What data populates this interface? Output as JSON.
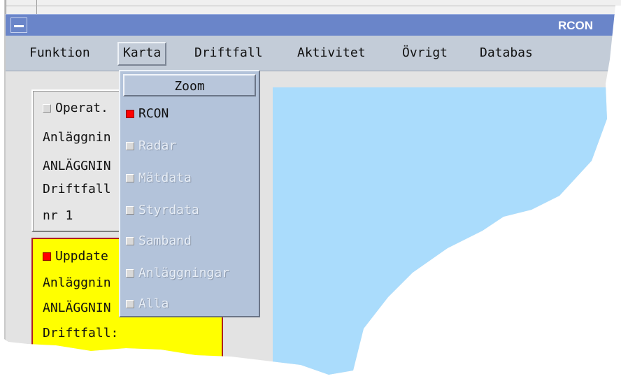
{
  "window": {
    "title": "RCON"
  },
  "menubar": {
    "items": [
      {
        "label": "Funktion"
      },
      {
        "label": "Karta"
      },
      {
        "label": "Driftfall"
      },
      {
        "label": "Aktivitet"
      },
      {
        "label": "Övrigt"
      },
      {
        "label": "Databas"
      }
    ]
  },
  "karta_menu": {
    "zoom_label": "Zoom",
    "items": [
      {
        "label": "RCON",
        "checked": true,
        "enabled": true
      },
      {
        "label": "Radar",
        "checked": false,
        "enabled": false
      },
      {
        "label": "Mätdata",
        "checked": false,
        "enabled": false
      },
      {
        "label": "Styrdata",
        "checked": false,
        "enabled": false
      },
      {
        "label": "Samband",
        "checked": false,
        "enabled": false
      },
      {
        "label": "Anläggningar",
        "checked": false,
        "enabled": false
      },
      {
        "label": "Alla",
        "checked": false,
        "enabled": false
      }
    ]
  },
  "panel_operator": {
    "header": "Operat.",
    "line1": "Anläggnin",
    "line2": "ANLÄGGNIN",
    "line3": "Driftfall",
    "line4": "nr 1"
  },
  "panel_update": {
    "header": "Uppdate",
    "line1": "Anläggnin",
    "line2": "ANLÄGGNIN",
    "line3": "Driftfall:"
  },
  "colors": {
    "titlebar": "#6a85c9",
    "menubar": "#c3ccd8",
    "map_water": "#aadcfc",
    "update_panel": "#ffff00",
    "checked": "#ff0000"
  }
}
